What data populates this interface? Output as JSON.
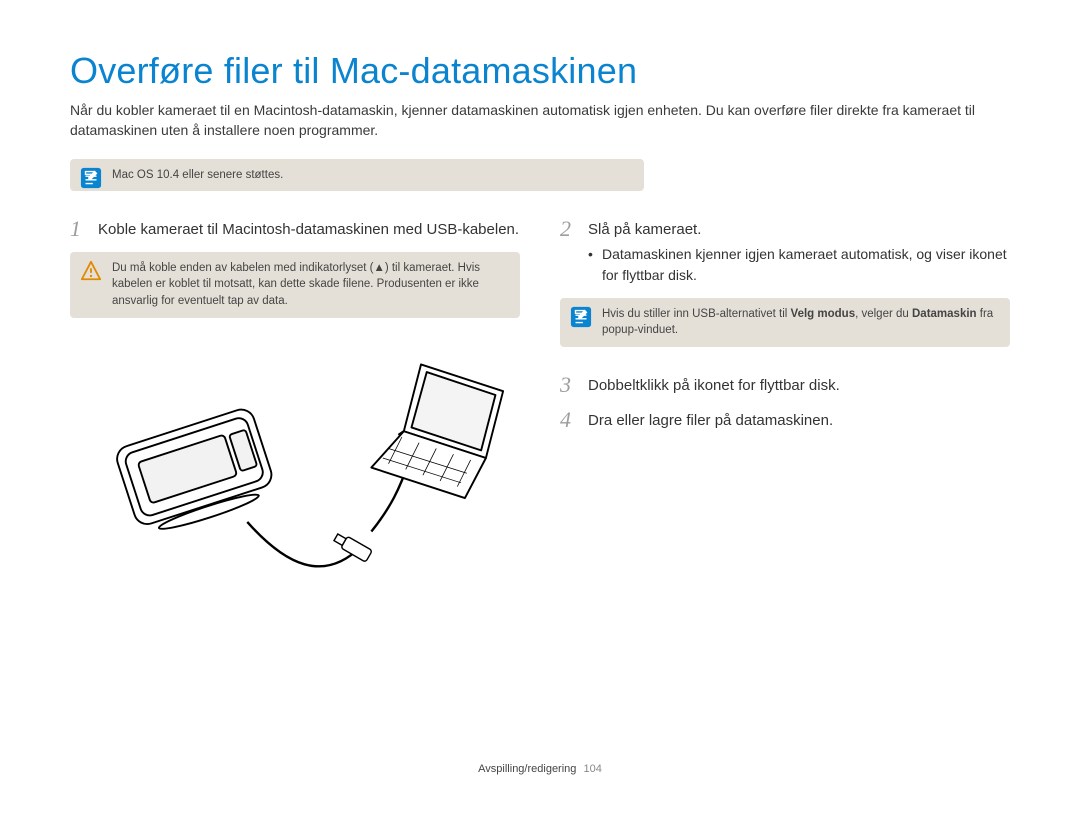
{
  "title": "Overføre filer til Mac-datamaskinen",
  "intro": "Når du kobler kameraet til en Macintosh-datamaskin, kjenner datamaskinen automatisk igjen enheten. Du kan overføre filer direkte fra kameraet til datamaskinen uten å installere noen programmer.",
  "note_top": "Mac OS 10.4 eller senere støttes.",
  "left": {
    "step1_num": "1",
    "step1_text": "Koble kameraet til Macintosh-datamaskinen med USB-kabelen.",
    "warn_text": "Du må koble enden av kabelen med indikatorlyset (▲) til kameraet. Hvis kabelen er koblet til motsatt, kan dette skade filene. Produsenten er ikke ansvarlig for eventuelt tap av data."
  },
  "right": {
    "step2_num": "2",
    "step2_text": "Slå på kameraet.",
    "step2_bullet": "Datamaskinen kjenner igjen kameraet automatisk, og viser ikonet for flyttbar disk.",
    "note2_pre": "Hvis du stiller inn USB-alternativet til ",
    "note2_bold1": "Velg modus",
    "note2_mid": ", velger du ",
    "note2_bold2": "Datamaskin",
    "note2_post": " fra popup-vinduet.",
    "step3_num": "3",
    "step3_text": "Dobbeltklikk på ikonet for flyttbar disk.",
    "step4_num": "4",
    "step4_text": "Dra eller lagre filer på datamaskinen."
  },
  "footer_section": "Avspilling/redigering",
  "footer_page": "104"
}
